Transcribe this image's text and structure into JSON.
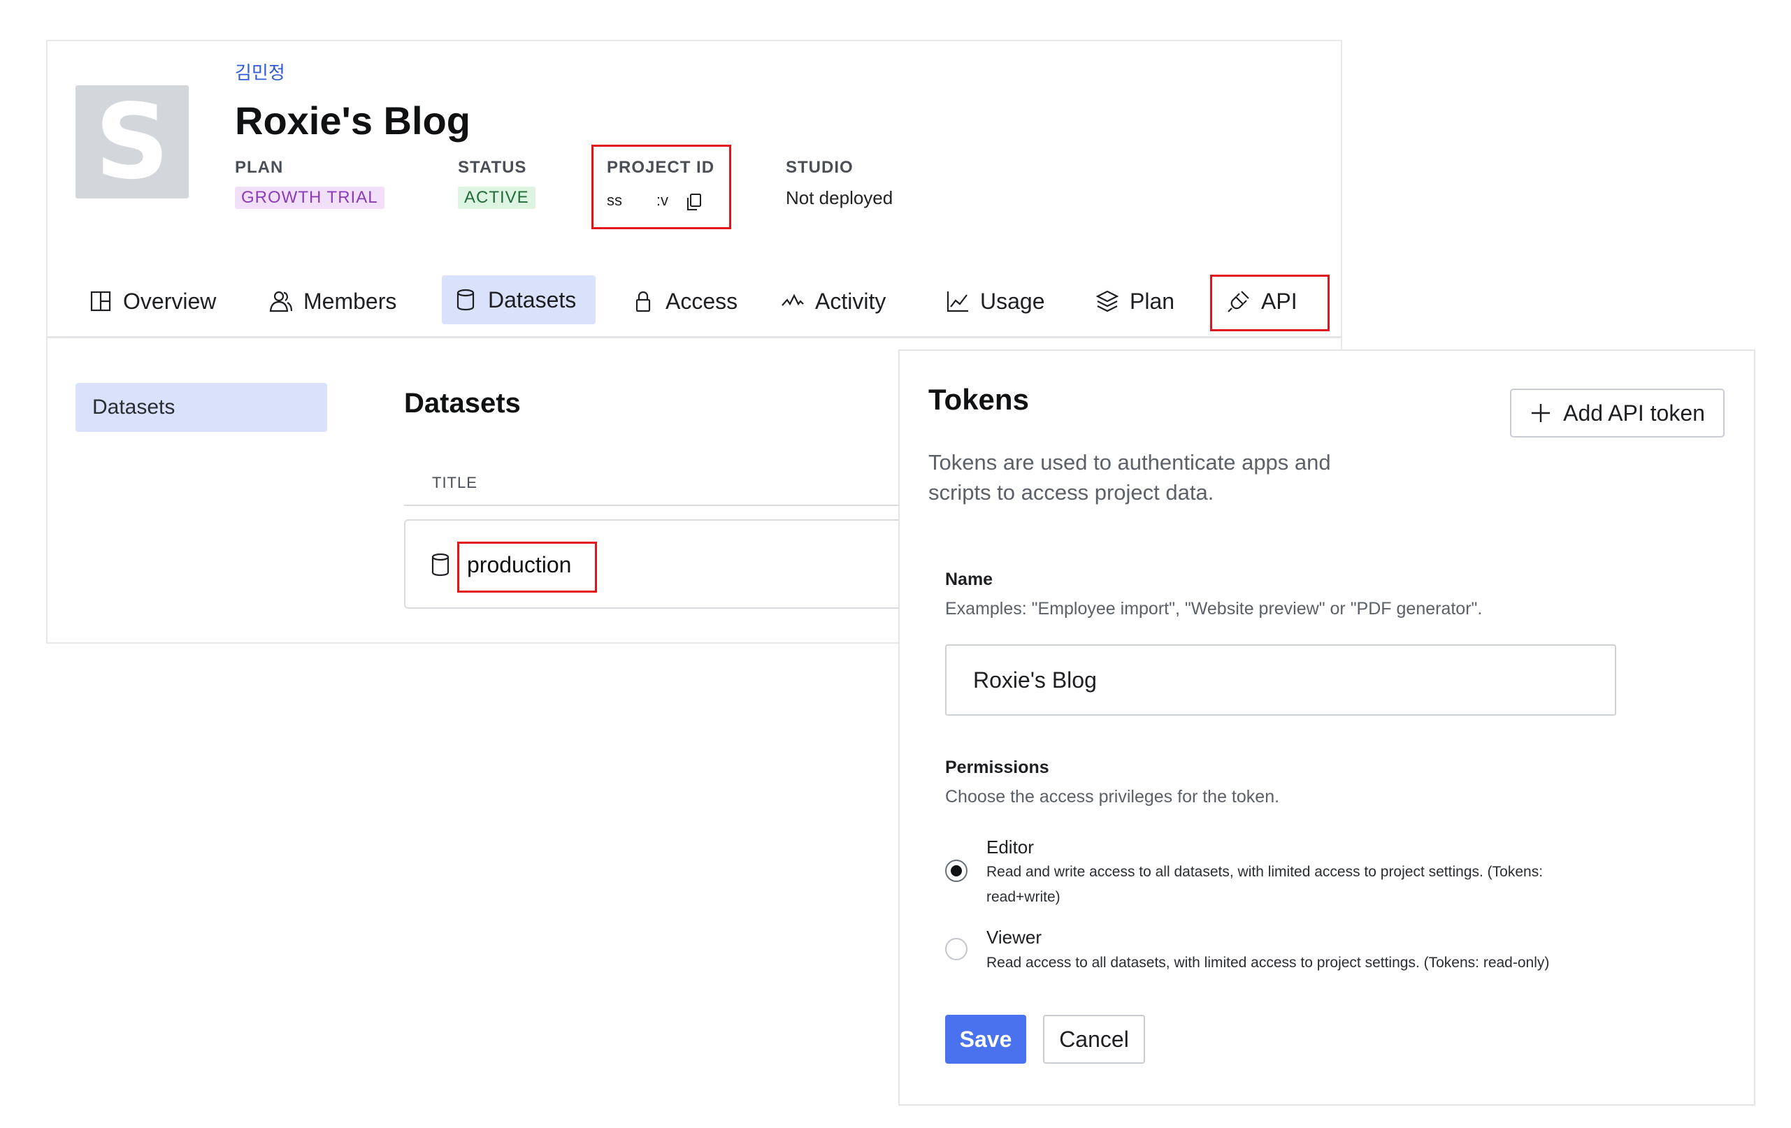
{
  "project": {
    "org_name": "김민정",
    "title": "Roxie's Blog",
    "avatar_letter": "S",
    "meta": {
      "plan_label": "PLAN",
      "plan_value": "GROWTH TRIAL",
      "status_label": "STATUS",
      "status_value": "ACTIVE",
      "project_id_label": "PROJECT ID",
      "project_id_value": "ss        :v",
      "studio_label": "STUDIO",
      "studio_value": "Not deployed"
    },
    "colors": {
      "plan_badge_bg": "#f2e0fb",
      "status_badge_bg": "#ddf4e3",
      "selected_tab_bg": "#d9e2fa",
      "highlight_box": "#e0161b"
    }
  },
  "tabs": [
    {
      "label": "Overview",
      "icon": "grid-icon"
    },
    {
      "label": "Members",
      "icon": "users-icon"
    },
    {
      "label": "Datasets",
      "icon": "database-icon",
      "selected": true
    },
    {
      "label": "Access",
      "icon": "lock-icon"
    },
    {
      "label": "Activity",
      "icon": "activity-icon"
    },
    {
      "label": "Usage",
      "icon": "chart-icon"
    },
    {
      "label": "Plan",
      "icon": "layers-icon"
    },
    {
      "label": "API",
      "icon": "plug-icon"
    }
  ],
  "datasets": {
    "sidebar_item": "Datasets",
    "heading": "Datasets",
    "column_title": "TITLE",
    "rows": [
      {
        "name": "production"
      }
    ]
  },
  "tokens": {
    "title": "Tokens",
    "description": "Tokens are used to authenticate apps and scripts to access project data.",
    "add_button": "Add API token",
    "name_label": "Name",
    "name_help": "Examples: \"Employee import\", \"Website preview\" or \"PDF generator\".",
    "name_value": "Roxie's Blog",
    "permissions_label": "Permissions",
    "permissions_help": "Choose the access privileges for the token.",
    "options": [
      {
        "title": "Editor",
        "desc": "Read and write access to all datasets, with limited access to project settings. (Tokens: read+write)",
        "selected": true
      },
      {
        "title": "Viewer",
        "desc": "Read access to all datasets, with limited access to project settings. (Tokens: read-only)",
        "selected": false
      }
    ],
    "save_label": "Save",
    "cancel_label": "Cancel",
    "save_color": "#4a72ef"
  }
}
